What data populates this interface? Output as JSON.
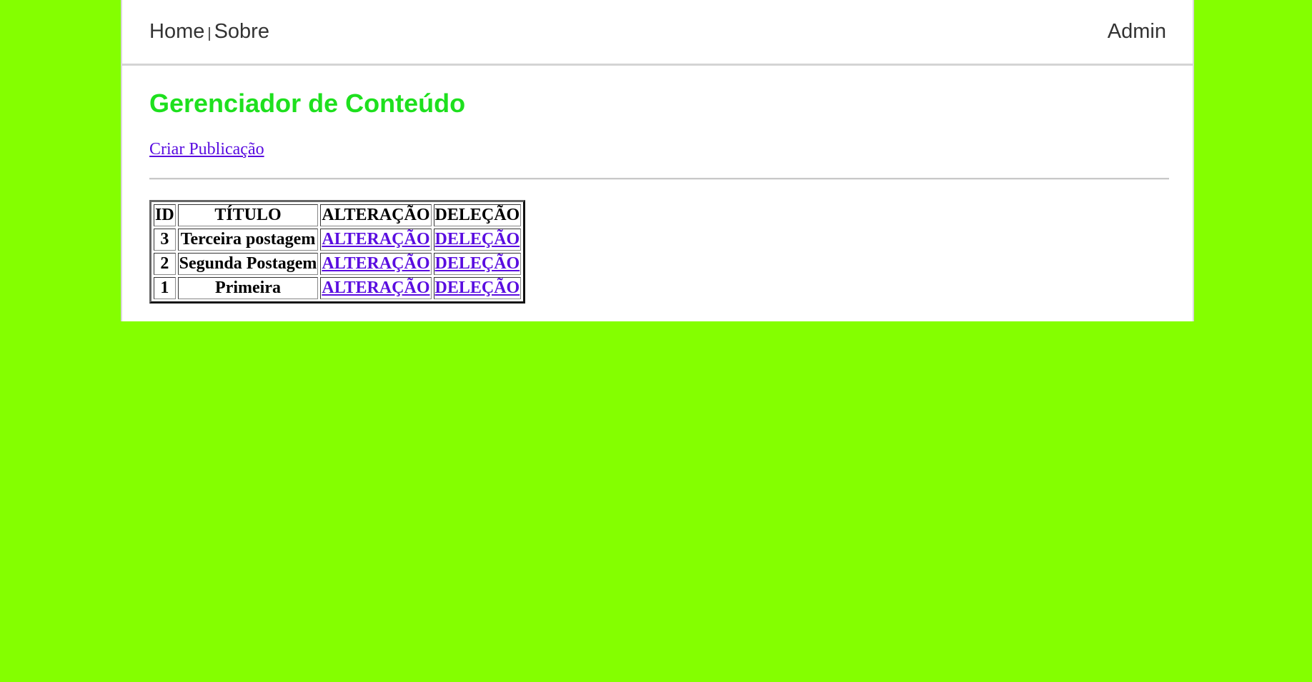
{
  "nav": {
    "home": "Home",
    "separator": "|",
    "about": "Sobre",
    "admin": "Admin"
  },
  "main": {
    "title": "Gerenciador de Conteúdo",
    "create_link": "Criar Publicação"
  },
  "table": {
    "headers": [
      "ID",
      "TÍTULO",
      "ALTERAÇÃO",
      "DELEÇÃO"
    ],
    "rows": [
      {
        "id": "3",
        "title": "Terceira postagem",
        "edit": "ALTERAÇÃO",
        "delete": "DELEÇÃO"
      },
      {
        "id": "2",
        "title": "Segunda Postagem",
        "edit": "ALTERAÇÃO",
        "delete": "DELEÇÃO"
      },
      {
        "id": "1",
        "title": "Primeira",
        "edit": "ALTERAÇÃO",
        "delete": "DELEÇÃO"
      }
    ]
  },
  "colors": {
    "background": "#84ff00",
    "title": "#1ee01e",
    "link": "#5a0de0"
  }
}
